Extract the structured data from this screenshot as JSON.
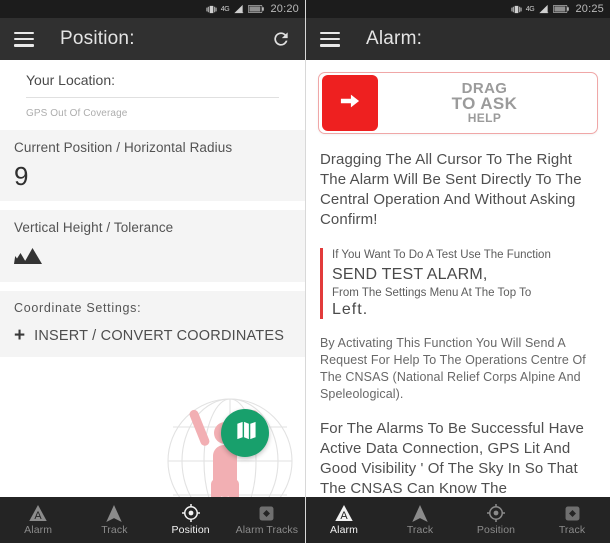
{
  "left": {
    "statusbar": {
      "network": "4G",
      "time": "20:20",
      "icons": [
        "vibrate-icon",
        "signal-icon",
        "battery-icon"
      ]
    },
    "appbar": {
      "menu_icon": "hamburger-icon",
      "title": "Position:",
      "action_icon": "refresh-icon"
    },
    "location": {
      "title": "Your Location:",
      "status": "GPS Out Of Coverage"
    },
    "position_card": {
      "label": "Current Position / Horizontal Radius",
      "value": "9"
    },
    "height_card": {
      "label": "Vertical Height / Tolerance",
      "icon": "mountain-icon"
    },
    "coordinates_card": {
      "label": "Coordinate Settings:",
      "action": "INSERT / CONVERT COORDINATES",
      "plus": "+"
    },
    "fab": {
      "icon": "map-icon",
      "color": "#18a06c"
    },
    "nav": [
      {
        "label": "Alarm",
        "icon": "alarm-triangle-icon",
        "active": false
      },
      {
        "label": "Track",
        "icon": "navigation-arrow-icon",
        "active": false
      },
      {
        "label": "Position",
        "icon": "crosshair-icon",
        "active": true
      },
      {
        "label": "Alarm Tracks",
        "icon": "alarm-tracks-icon",
        "active": false
      }
    ]
  },
  "right": {
    "statusbar": {
      "network": "4G",
      "time": "20:25",
      "icons": [
        "vibrate-icon",
        "signal-icon",
        "battery-icon"
      ]
    },
    "appbar": {
      "menu_icon": "hamburger-icon",
      "title": "Alarm:"
    },
    "drag_slider": {
      "line1": "DRAG",
      "line2": "TO ASK",
      "line3": "HELP",
      "knob_icon": "arrow-right-icon",
      "knob_color": "#ee2020"
    },
    "intro": "Dragging The All Cursor To The Right The Alarm Will Be Sent Directly To The Central Operation And Without Asking Confirm!",
    "quote": {
      "top": "If You Want To Do A Test Use The Function",
      "highlight": "SEND TEST ALARM,",
      "bottom": "From The Settings Menu At The Top To",
      "end": "Left."
    },
    "detail": "By Activating This Function You Will Send A Request For Help To The Operations Centre Of The CNSAS (National Relief Corps Alpine And Speleological).",
    "requirements": "For The Alarms To Be Successful Have Active Data Connection, GPS Lit And Good Visibility ' Of The Sky In So That The CNSAS Can Know The",
    "nav": [
      {
        "label": "Alarm",
        "icon": "alarm-triangle-icon",
        "active": true
      },
      {
        "label": "Track",
        "icon": "navigation-arrow-icon",
        "active": false
      },
      {
        "label": "Position",
        "icon": "crosshair-icon",
        "active": false
      },
      {
        "label": "Track",
        "icon": "alarm-tracks-icon",
        "active": false
      }
    ]
  }
}
